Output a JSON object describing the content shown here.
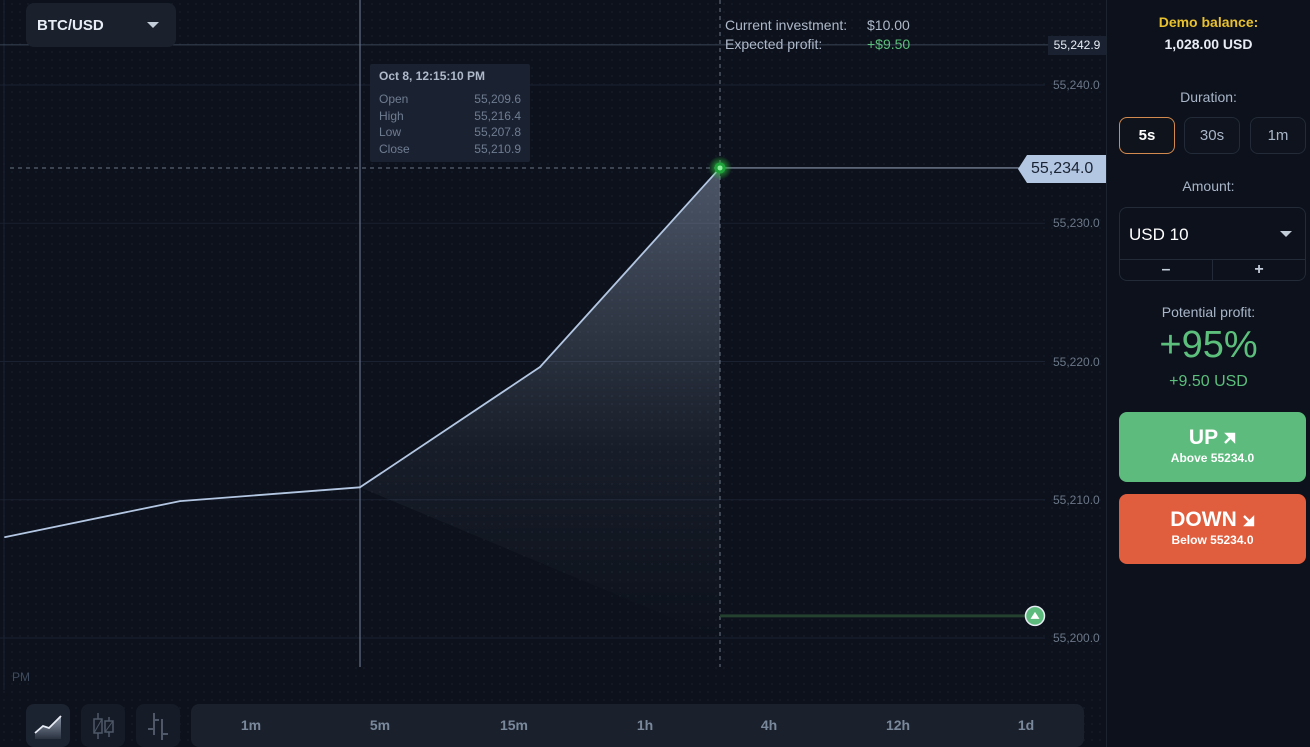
{
  "header": {
    "pair": "BTC/USD"
  },
  "tooltip": {
    "title": "Oct 8, 12:15:10 PM",
    "rows": [
      {
        "label": "Open",
        "value": "55,209.6"
      },
      {
        "label": "High",
        "value": "55,216.4"
      },
      {
        "label": "Low",
        "value": "55,207.8"
      },
      {
        "label": "Close",
        "value": "55,210.9"
      }
    ]
  },
  "investment": {
    "current_label": "Current investment:",
    "current_value": "$10.00",
    "profit_label": "Expected profit:",
    "profit_value": "+$9.50"
  },
  "chart": {
    "y_ticks": [
      "55,240.0",
      "55,230.0",
      "55,220.0",
      "55,210.0",
      "55,200.0"
    ],
    "crosshair_price": "55,242.9",
    "current_price": "55,234.0",
    "time_label": "PM"
  },
  "chart_data": {
    "type": "line",
    "title": "BTC/USD",
    "xlabel": "",
    "ylabel": "",
    "ylim": [
      55197.5,
      55243.5
    ],
    "y_ticks": [
      55200,
      55210,
      55220,
      55230,
      55240
    ],
    "points": [
      {
        "x": 0,
        "y": 55207.3
      },
      {
        "x": 1,
        "y": 55209.9
      },
      {
        "x": 2,
        "y": 55210.9
      },
      {
        "x": 3,
        "y": 55219.6
      },
      {
        "x": 4,
        "y": 55234.0
      }
    ],
    "current_price": 55234.0,
    "crosshair_price": 55242.9,
    "open_position": {
      "direction": "up",
      "level": 55201.6
    },
    "grid": true
  },
  "chart_types": [
    {
      "name": "area-chart",
      "active": true
    },
    {
      "name": "candles-chart",
      "active": false
    },
    {
      "name": "bars-chart",
      "active": false
    }
  ],
  "timeframes": [
    "1m",
    "5m",
    "15m",
    "1h",
    "4h",
    "12h",
    "1d"
  ],
  "side": {
    "demo_label": "Demo balance:",
    "demo_value": "1,028.00 USD",
    "duration_label": "Duration:",
    "durations": [
      "5s",
      "30s",
      "1m"
    ],
    "duration_selected": "5s",
    "amount_label": "Amount:",
    "amount_value": "USD 10",
    "minus": "–",
    "plus": "+",
    "potential_label": "Potential profit:",
    "potential_pct": "+95%",
    "potential_usd": "+9.50 USD",
    "up_label": "UP",
    "up_sub": "Above 55234.0",
    "down_label": "DOWN",
    "down_sub": "Below 55234.0"
  },
  "colors": {
    "up": "#5cbb7d",
    "down": "#e05d3d",
    "accent_border": "#d38a4e",
    "demo": "#e9c12e",
    "profit": "#5cbf7c",
    "line": "#b3c6e2"
  }
}
